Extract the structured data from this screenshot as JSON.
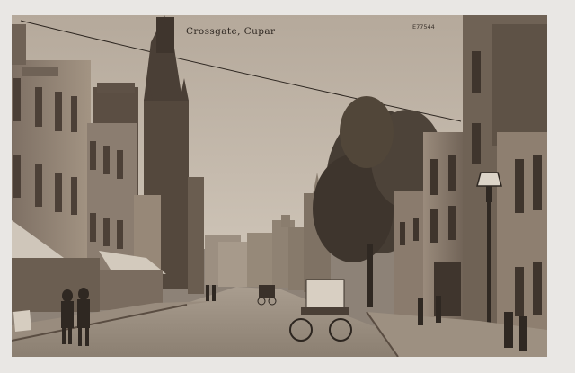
{
  "postcard": {
    "caption": "Crossgate, Cupar",
    "serial": "E77544",
    "tone": "sepia",
    "palette": {
      "border": "#e9e7e4",
      "sky": "#bdb1a3",
      "stone_dark": "#5a4d42",
      "stone_mid": "#8a7c6f",
      "road": "#a09485",
      "tree": "#3f372f"
    }
  }
}
